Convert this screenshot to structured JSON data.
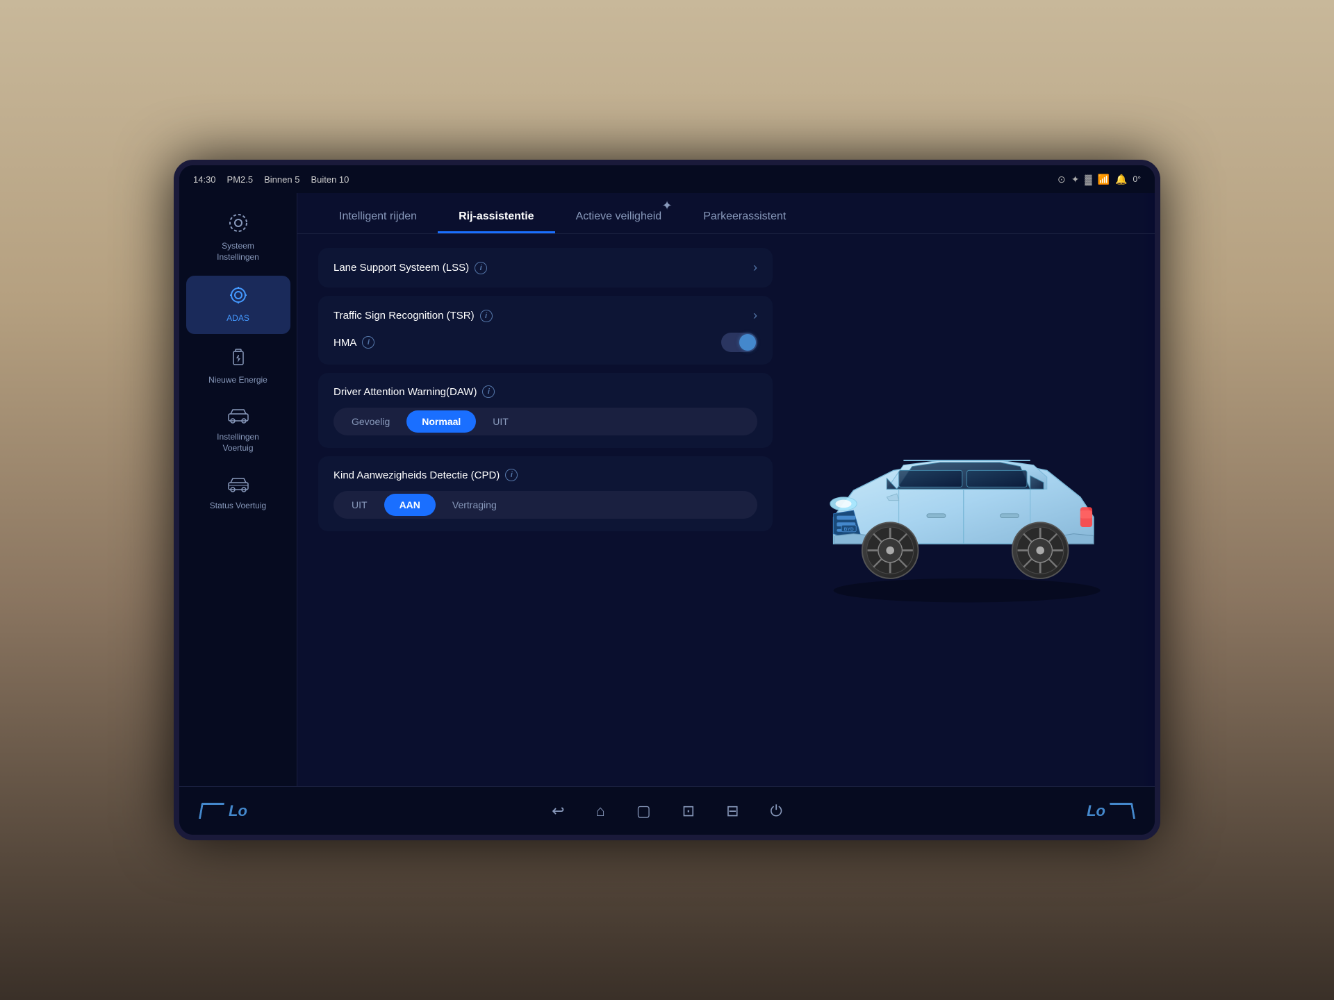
{
  "statusBar": {
    "time": "14:30",
    "airQuality": "PM2.5",
    "indoor": "Binnen 5",
    "outdoor": "Buiten 10",
    "temperature": "0°"
  },
  "sidebar": {
    "items": [
      {
        "id": "systeem",
        "label": "Systeem\nInstellingen",
        "icon": "⚙",
        "active": false
      },
      {
        "id": "adas",
        "label": "ADAS",
        "icon": "🎯",
        "active": true
      },
      {
        "id": "energie",
        "label": "Nieuwe Energie",
        "icon": "⚡",
        "active": false
      },
      {
        "id": "voertuig-inst",
        "label": "Instellingen\nVoertuig",
        "icon": "🚗",
        "active": false
      },
      {
        "id": "status",
        "label": "Status Voertuig",
        "icon": "📊",
        "active": false
      }
    ]
  },
  "tabs": [
    {
      "id": "intelligent",
      "label": "Intelligent rijden",
      "active": false
    },
    {
      "id": "rij-assistentie",
      "label": "Rij-assistentie",
      "active": true
    },
    {
      "id": "actieve-veiligheid",
      "label": "Actieve veiligheid",
      "active": false
    },
    {
      "id": "parkeerassistent",
      "label": "Parkeerassistent",
      "active": false
    }
  ],
  "settings": {
    "lss": {
      "label": "Lane Support Systeem (LSS)",
      "hasChevron": true,
      "hasInfo": true
    },
    "tsr": {
      "label": "Traffic Sign Recognition (TSR)",
      "hasChevron": true,
      "hasInfo": true
    },
    "hma": {
      "label": "HMA",
      "hasInfo": true,
      "toggleOn": true
    },
    "daw": {
      "label": "Driver Attention Warning(DAW)",
      "hasInfo": true,
      "options": [
        "Gevoelig",
        "Normaal",
        "UIT"
      ],
      "activeOption": "Normaal"
    },
    "cpd": {
      "label": "Kind Aanwezigheids Detectie (CPD)",
      "hasInfo": true,
      "options": [
        "UIT",
        "AAN",
        "Vertraging"
      ],
      "activeOption": "AAN"
    }
  },
  "bottomNav": {
    "logoLeft": "Lo",
    "logoRight": "Lo",
    "icons": [
      "back",
      "home",
      "square",
      "cast",
      "split",
      "power"
    ]
  }
}
